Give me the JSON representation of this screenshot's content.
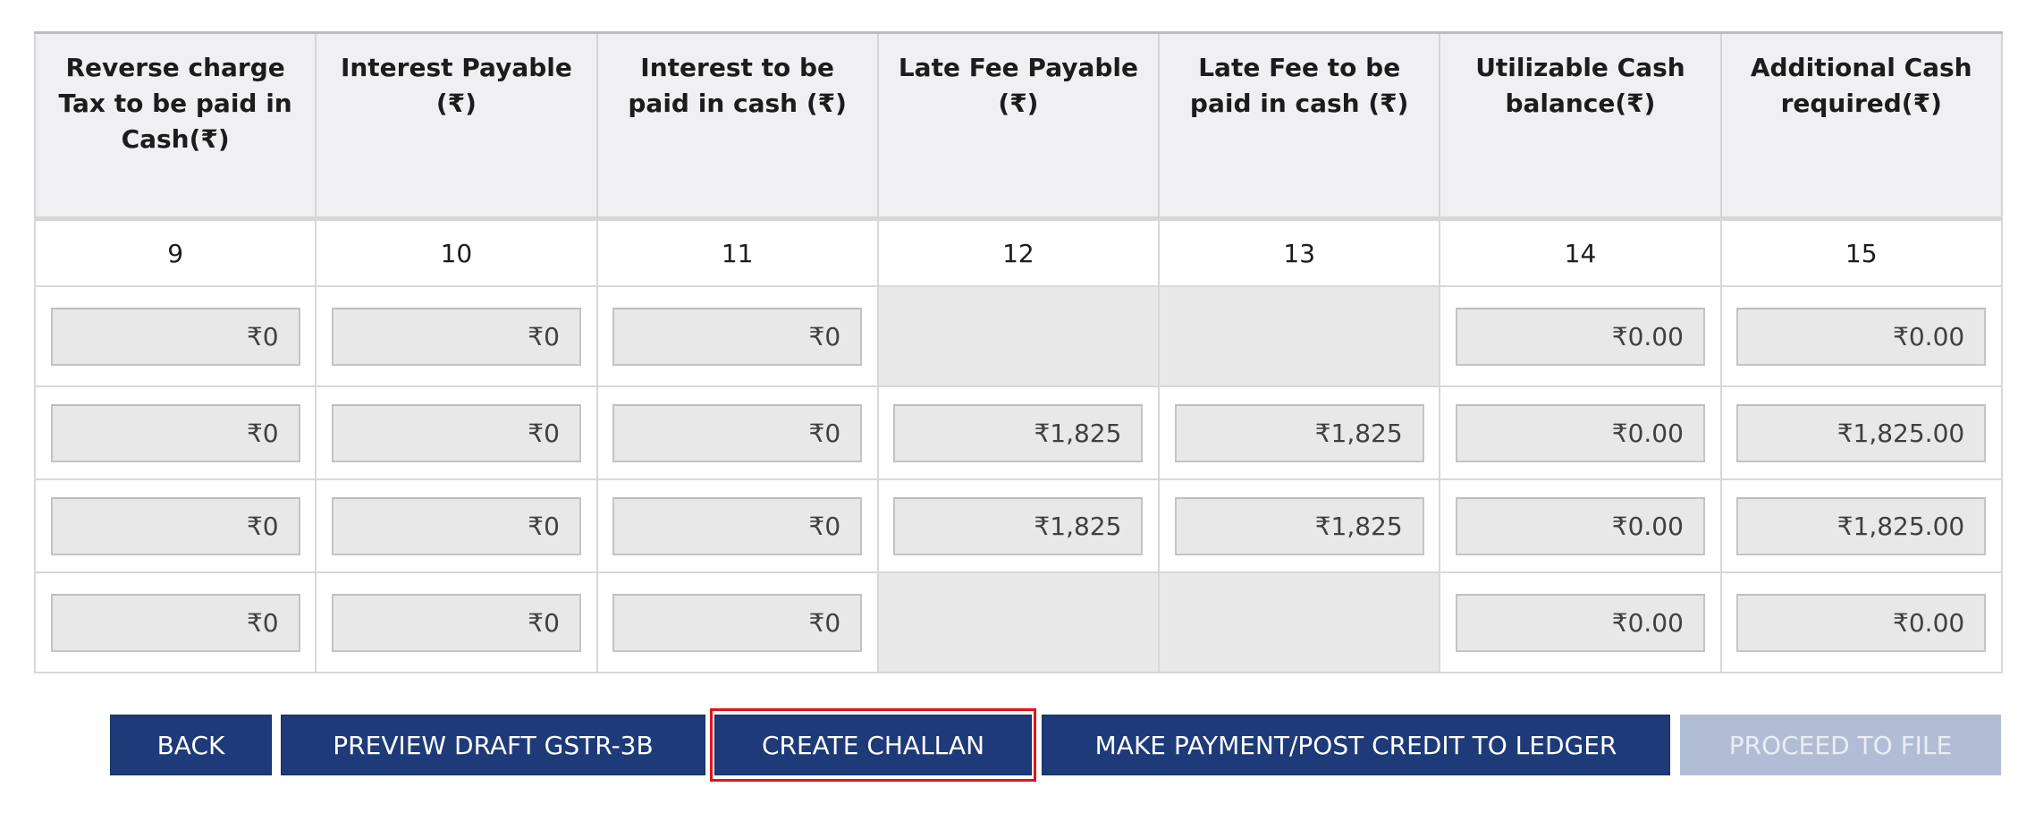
{
  "table": {
    "headers": [
      "Reverse charge Tax to be paid in Cash(₹)",
      "Interest Payable (₹)",
      "Interest to be paid in cash (₹)",
      "Late Fee Payable (₹)",
      "Late Fee to be paid in cash (₹)",
      "Utilizable Cash balance(₹)",
      "Additional Cash required(₹)"
    ],
    "column_numbers": [
      "9",
      "10",
      "11",
      "12",
      "13",
      "14",
      "15"
    ],
    "rows": [
      [
        "₹0",
        "₹0",
        "₹0",
        null,
        null,
        "₹0.00",
        "₹0.00"
      ],
      [
        "₹0",
        "₹0",
        "₹0",
        "₹1,825",
        "₹1,825",
        "₹0.00",
        "₹1,825.00"
      ],
      [
        "₹0",
        "₹0",
        "₹0",
        "₹1,825",
        "₹1,825",
        "₹0.00",
        "₹1,825.00"
      ],
      [
        "₹0",
        "₹0",
        "₹0",
        null,
        null,
        "₹0.00",
        "₹0.00"
      ]
    ]
  },
  "actions": {
    "back": "BACK",
    "preview": "PREVIEW DRAFT GSTR-3B",
    "create_challan": "CREATE CHALLAN",
    "make_payment": "MAKE PAYMENT/POST CREDIT TO LEDGER",
    "proceed": "PROCEED TO FILE"
  },
  "colors": {
    "primary_button": "#1e3a78",
    "disabled_button": "#b0bdd5",
    "highlight_outline": "#e0141a",
    "header_bg": "#f0f0f2",
    "input_bg": "#e8e8e8"
  }
}
